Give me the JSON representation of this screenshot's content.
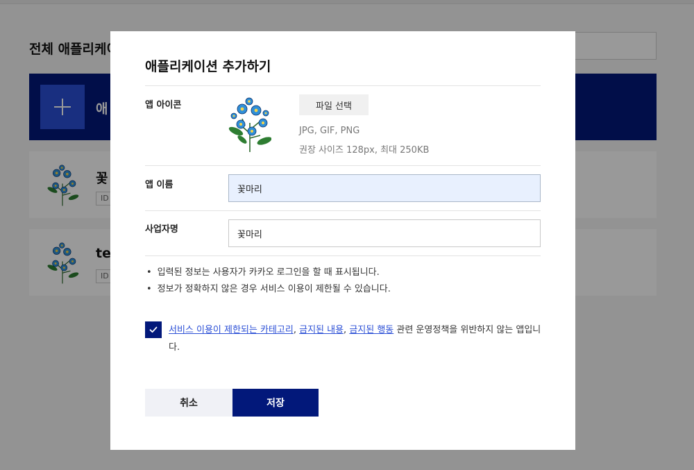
{
  "background": {
    "page_title": "전체 애플리케이",
    "add_card_label": "애",
    "apps": [
      {
        "name": "꽃",
        "id_prefix": "ID"
      },
      {
        "name": "tes",
        "id_prefix": "ID"
      }
    ]
  },
  "modal": {
    "title": "애플리케이션 추가하기",
    "icon_section": {
      "label": "앱 아이콘",
      "file_button": "파일 선택",
      "formats": "JPG, GIF, PNG",
      "size_hint": "권장 사이즈 128px, 최대 250KB",
      "icon_name": "forget-me-not-flower-icon"
    },
    "app_name": {
      "label": "앱 이름",
      "value": "꽃마리"
    },
    "company_name": {
      "label": "사업자명",
      "value": "꽃마리"
    },
    "notes": [
      "입력된 정보는 사용자가 카카오 로그인을 할 때 표시됩니다.",
      "정보가 정확하지 않은 경우 서비스 이용이 제한될 수 있습니다."
    ],
    "agreement": {
      "checked": true,
      "link1": "서비스 이용이 제한되는 카테고리",
      "sep1": ", ",
      "link2": "금지된 내용",
      "sep2": ", ",
      "link3": "금지된 행동",
      "suffix": " 관련 운영정책을 위반하지 않는 앱입니다."
    },
    "buttons": {
      "cancel": "취소",
      "save": "저장"
    }
  },
  "colors": {
    "brand_navy": "#02187a",
    "brand_blue": "#2b4fd6",
    "link": "#2b4fd6",
    "autofill_bg": "#e8f0fe"
  }
}
